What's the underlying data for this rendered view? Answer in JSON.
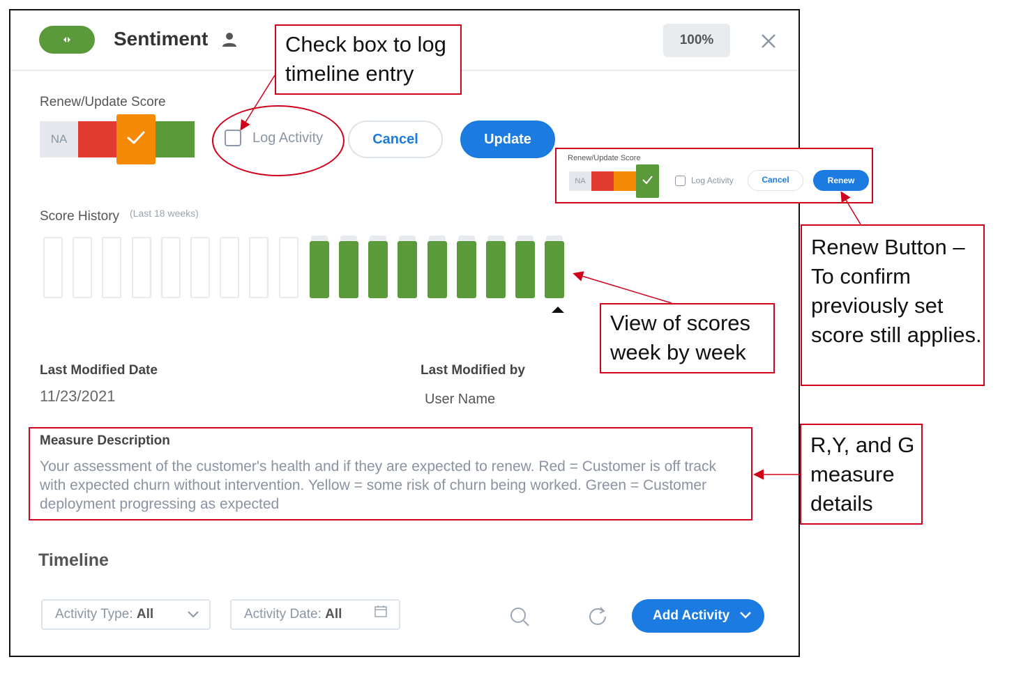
{
  "header": {
    "title": "Sentiment",
    "percent": "100%"
  },
  "score": {
    "label": "Renew/Update Score",
    "na_label": "NA",
    "selected": "yellow",
    "log_activity_label": "Log Activity",
    "log_activity_checked": false,
    "cancel_label": "Cancel",
    "update_label": "Update"
  },
  "history": {
    "label": "Score History",
    "sublabel": "(Last 18 weeks)",
    "weeks": [
      "empty",
      "empty",
      "empty",
      "empty",
      "empty",
      "empty",
      "empty",
      "empty",
      "empty",
      "green",
      "green",
      "green",
      "green",
      "green",
      "green",
      "green",
      "green",
      "green"
    ]
  },
  "meta": {
    "last_modified_date_label": "Last Modified Date",
    "last_modified_date": "11/23/2021",
    "last_modified_by_label": "Last Modified by",
    "last_modified_by": "User Name"
  },
  "description": {
    "title": "Measure Description",
    "text": "Your assessment of the customer's health and if they are expected to renew. Red = Customer is off track with expected churn without intervention. Yellow = some risk of churn being worked. Green = Customer deployment progressing as expected"
  },
  "timeline": {
    "title": "Timeline",
    "activity_type_label": "Activity Type:",
    "activity_type_value": "All",
    "activity_date_label": "Activity Date:",
    "activity_date_value": "All",
    "add_activity_label": "Add Activity"
  },
  "mini_panel": {
    "label": "Renew/Update Score",
    "na_label": "NA",
    "log_activity_label": "Log Activity",
    "cancel_label": "Cancel",
    "renew_label": "Renew"
  },
  "callouts": {
    "log_entry": "Check box to log timeline entry",
    "renew_button": "Renew Button – To confirm previously set score still applies.",
    "weekly_view": "View of scores week by week",
    "measure_details": "R,Y, and G measure details"
  },
  "colors": {
    "red": "#e03c31",
    "yellow": "#f58a07",
    "green": "#5b9a3a",
    "primary": "#1b7be0",
    "callout_border": "#d0021b"
  }
}
